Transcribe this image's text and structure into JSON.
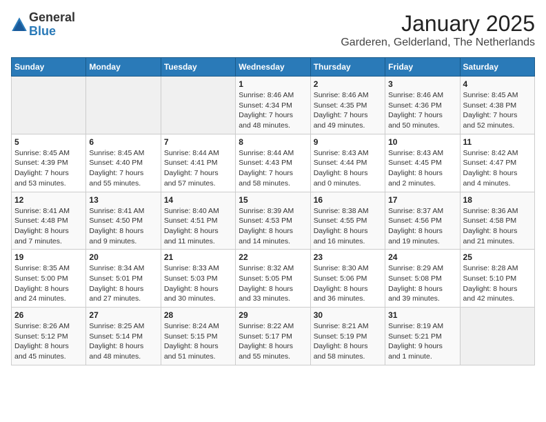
{
  "logo": {
    "general": "General",
    "blue": "Blue"
  },
  "title": "January 2025",
  "location": "Garderen, Gelderland, The Netherlands",
  "days_header": [
    "Sunday",
    "Monday",
    "Tuesday",
    "Wednesday",
    "Thursday",
    "Friday",
    "Saturday"
  ],
  "weeks": [
    [
      {
        "day": "",
        "info": ""
      },
      {
        "day": "",
        "info": ""
      },
      {
        "day": "",
        "info": ""
      },
      {
        "day": "1",
        "info": "Sunrise: 8:46 AM\nSunset: 4:34 PM\nDaylight: 7 hours\nand 48 minutes."
      },
      {
        "day": "2",
        "info": "Sunrise: 8:46 AM\nSunset: 4:35 PM\nDaylight: 7 hours\nand 49 minutes."
      },
      {
        "day": "3",
        "info": "Sunrise: 8:46 AM\nSunset: 4:36 PM\nDaylight: 7 hours\nand 50 minutes."
      },
      {
        "day": "4",
        "info": "Sunrise: 8:45 AM\nSunset: 4:38 PM\nDaylight: 7 hours\nand 52 minutes."
      }
    ],
    [
      {
        "day": "5",
        "info": "Sunrise: 8:45 AM\nSunset: 4:39 PM\nDaylight: 7 hours\nand 53 minutes."
      },
      {
        "day": "6",
        "info": "Sunrise: 8:45 AM\nSunset: 4:40 PM\nDaylight: 7 hours\nand 55 minutes."
      },
      {
        "day": "7",
        "info": "Sunrise: 8:44 AM\nSunset: 4:41 PM\nDaylight: 7 hours\nand 57 minutes."
      },
      {
        "day": "8",
        "info": "Sunrise: 8:44 AM\nSunset: 4:43 PM\nDaylight: 7 hours\nand 58 minutes."
      },
      {
        "day": "9",
        "info": "Sunrise: 8:43 AM\nSunset: 4:44 PM\nDaylight: 8 hours\nand 0 minutes."
      },
      {
        "day": "10",
        "info": "Sunrise: 8:43 AM\nSunset: 4:45 PM\nDaylight: 8 hours\nand 2 minutes."
      },
      {
        "day": "11",
        "info": "Sunrise: 8:42 AM\nSunset: 4:47 PM\nDaylight: 8 hours\nand 4 minutes."
      }
    ],
    [
      {
        "day": "12",
        "info": "Sunrise: 8:41 AM\nSunset: 4:48 PM\nDaylight: 8 hours\nand 7 minutes."
      },
      {
        "day": "13",
        "info": "Sunrise: 8:41 AM\nSunset: 4:50 PM\nDaylight: 8 hours\nand 9 minutes."
      },
      {
        "day": "14",
        "info": "Sunrise: 8:40 AM\nSunset: 4:51 PM\nDaylight: 8 hours\nand 11 minutes."
      },
      {
        "day": "15",
        "info": "Sunrise: 8:39 AM\nSunset: 4:53 PM\nDaylight: 8 hours\nand 14 minutes."
      },
      {
        "day": "16",
        "info": "Sunrise: 8:38 AM\nSunset: 4:55 PM\nDaylight: 8 hours\nand 16 minutes."
      },
      {
        "day": "17",
        "info": "Sunrise: 8:37 AM\nSunset: 4:56 PM\nDaylight: 8 hours\nand 19 minutes."
      },
      {
        "day": "18",
        "info": "Sunrise: 8:36 AM\nSunset: 4:58 PM\nDaylight: 8 hours\nand 21 minutes."
      }
    ],
    [
      {
        "day": "19",
        "info": "Sunrise: 8:35 AM\nSunset: 5:00 PM\nDaylight: 8 hours\nand 24 minutes."
      },
      {
        "day": "20",
        "info": "Sunrise: 8:34 AM\nSunset: 5:01 PM\nDaylight: 8 hours\nand 27 minutes."
      },
      {
        "day": "21",
        "info": "Sunrise: 8:33 AM\nSunset: 5:03 PM\nDaylight: 8 hours\nand 30 minutes."
      },
      {
        "day": "22",
        "info": "Sunrise: 8:32 AM\nSunset: 5:05 PM\nDaylight: 8 hours\nand 33 minutes."
      },
      {
        "day": "23",
        "info": "Sunrise: 8:30 AM\nSunset: 5:06 PM\nDaylight: 8 hours\nand 36 minutes."
      },
      {
        "day": "24",
        "info": "Sunrise: 8:29 AM\nSunset: 5:08 PM\nDaylight: 8 hours\nand 39 minutes."
      },
      {
        "day": "25",
        "info": "Sunrise: 8:28 AM\nSunset: 5:10 PM\nDaylight: 8 hours\nand 42 minutes."
      }
    ],
    [
      {
        "day": "26",
        "info": "Sunrise: 8:26 AM\nSunset: 5:12 PM\nDaylight: 8 hours\nand 45 minutes."
      },
      {
        "day": "27",
        "info": "Sunrise: 8:25 AM\nSunset: 5:14 PM\nDaylight: 8 hours\nand 48 minutes."
      },
      {
        "day": "28",
        "info": "Sunrise: 8:24 AM\nSunset: 5:15 PM\nDaylight: 8 hours\nand 51 minutes."
      },
      {
        "day": "29",
        "info": "Sunrise: 8:22 AM\nSunset: 5:17 PM\nDaylight: 8 hours\nand 55 minutes."
      },
      {
        "day": "30",
        "info": "Sunrise: 8:21 AM\nSunset: 5:19 PM\nDaylight: 8 hours\nand 58 minutes."
      },
      {
        "day": "31",
        "info": "Sunrise: 8:19 AM\nSunset: 5:21 PM\nDaylight: 9 hours\nand 1 minute."
      },
      {
        "day": "",
        "info": ""
      }
    ]
  ]
}
